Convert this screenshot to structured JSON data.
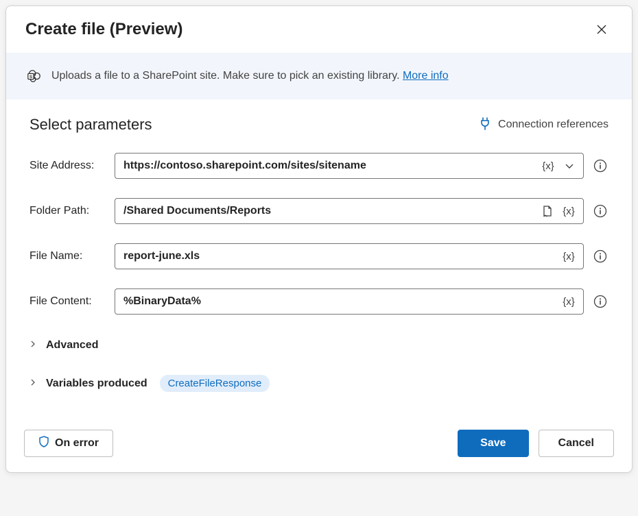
{
  "dialog": {
    "title": "Create file (Preview)"
  },
  "banner": {
    "text": "Uploads a file to a SharePoint site. Make sure to pick an existing library. ",
    "link_label": "More info"
  },
  "params": {
    "heading": "Select parameters",
    "connection_ref_label": "Connection references"
  },
  "fields": {
    "site_address": {
      "label": "Site Address:",
      "value": "https://contoso.sharepoint.com/sites/sitename"
    },
    "folder_path": {
      "label": "Folder Path:",
      "value": "/Shared Documents/Reports"
    },
    "file_name": {
      "label": "File Name:",
      "value": "report-june.xls"
    },
    "file_content": {
      "label": "File Content:",
      "value": "%BinaryData%"
    }
  },
  "tokens": {
    "variable": "{x}"
  },
  "sections": {
    "advanced_label": "Advanced",
    "variables_produced_label": "Variables produced",
    "variable_pill": "CreateFileResponse"
  },
  "footer": {
    "on_error": "On error",
    "save": "Save",
    "cancel": "Cancel"
  }
}
